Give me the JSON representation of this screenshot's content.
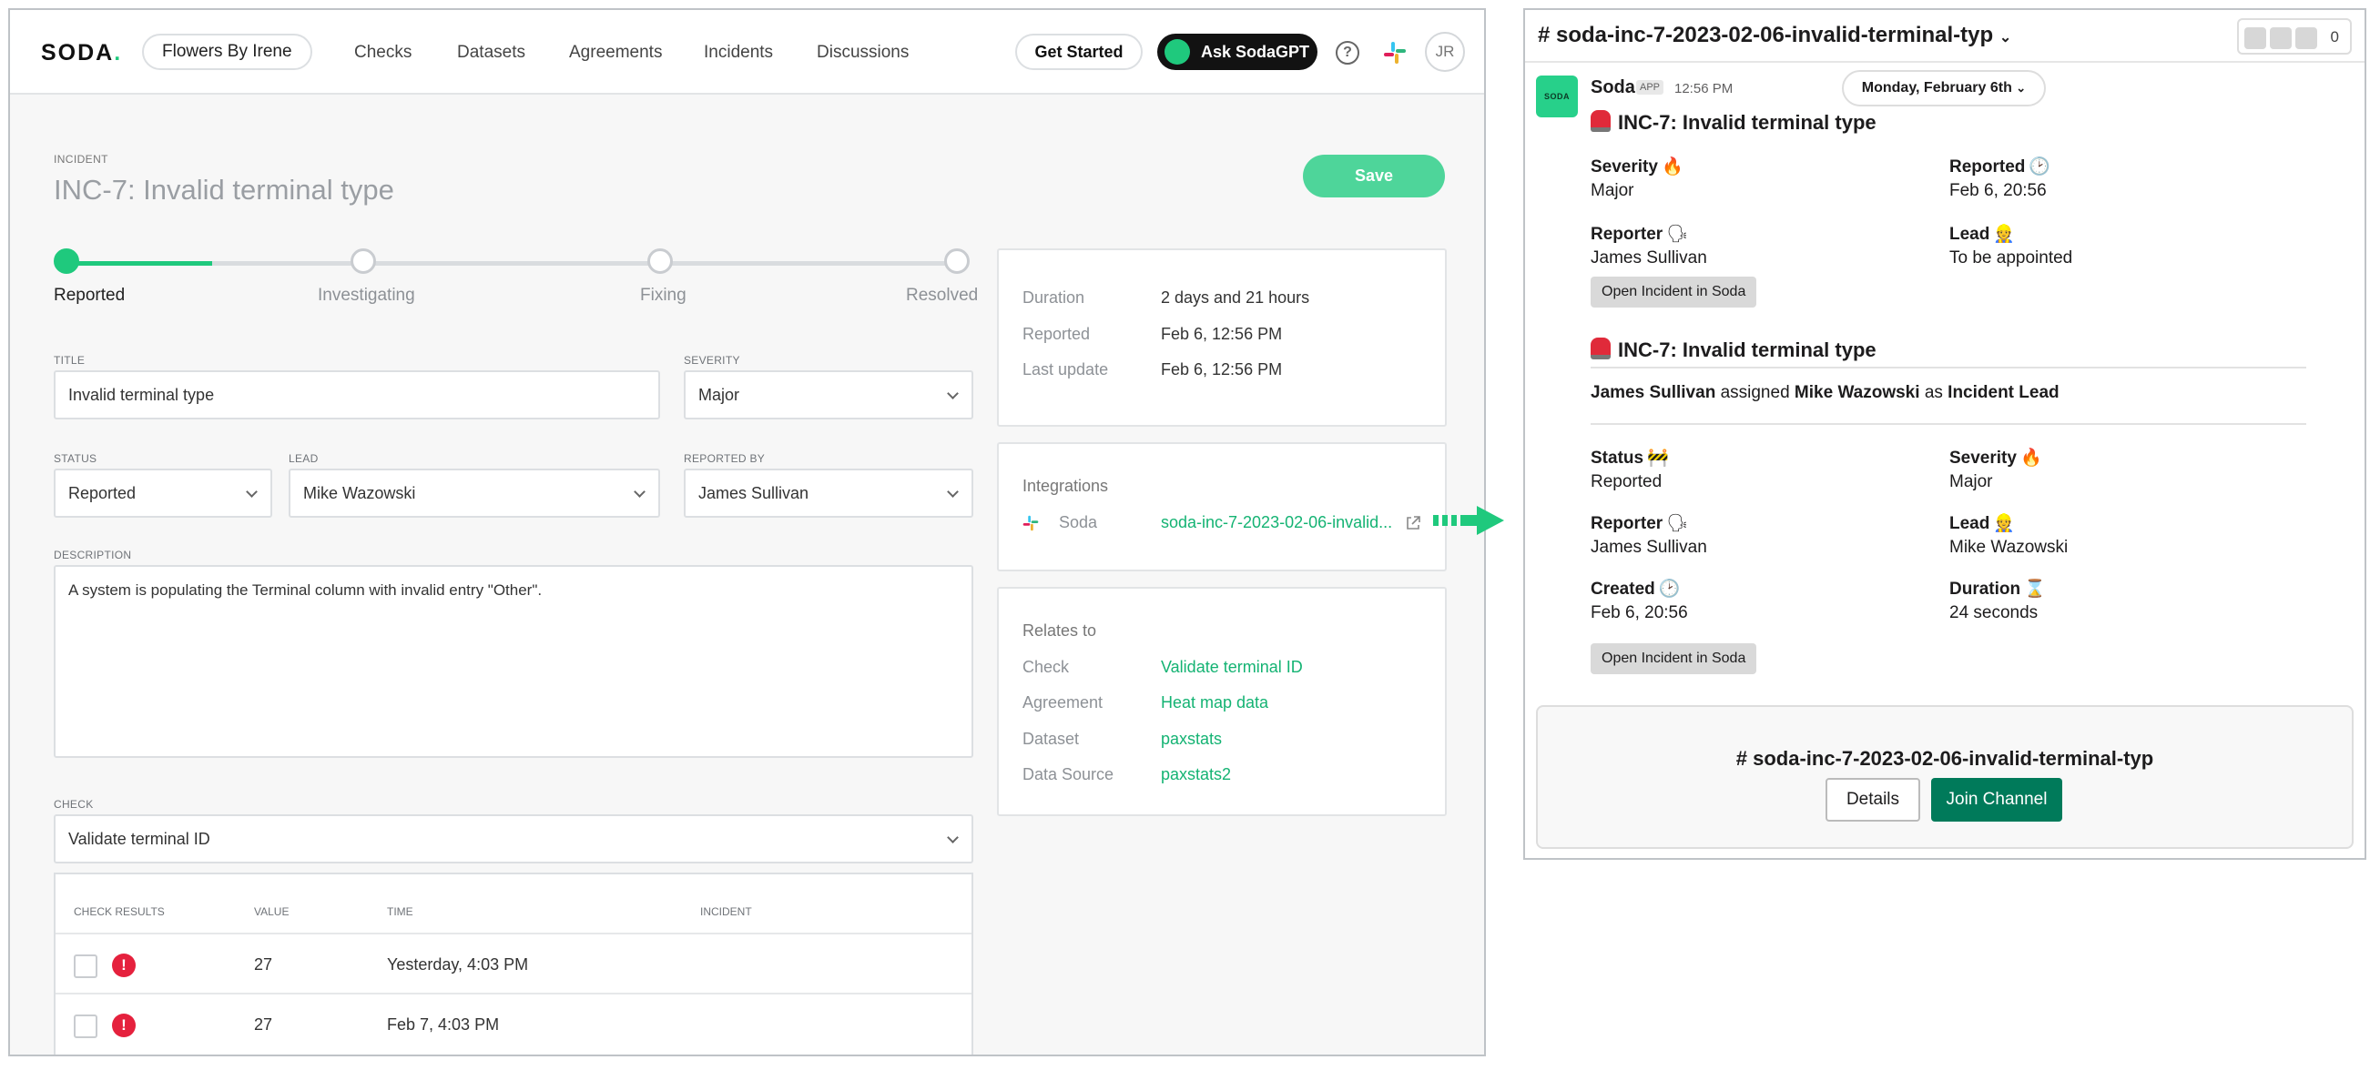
{
  "soda": {
    "logo": "SODA",
    "org": "Flowers By Irene",
    "nav": [
      "Checks",
      "Datasets",
      "Agreements",
      "Incidents",
      "Discussions"
    ],
    "get_started": "Get Started",
    "ask_gpt": "Ask SodaGPT",
    "help": "?",
    "avatar": "JR",
    "incident_label": "INCIDENT",
    "incident_title": "INC-7: Invalid terminal type",
    "save": "Save",
    "steps": [
      "Reported",
      "Investigating",
      "Fixing",
      "Resolved"
    ],
    "progress_step": 1,
    "title_label": "TITLE",
    "title_value": "Invalid terminal type",
    "severity_label": "SEVERITY",
    "severity_value": "Major",
    "status_label": "STATUS",
    "status_value": "Reported",
    "lead_label": "LEAD",
    "lead_value": "Mike Wazowski",
    "reported_by_label": "REPORTED BY",
    "reported_by_value": "James Sullivan",
    "description_label": "DESCRIPTION",
    "description_value": "A system is populating the Terminal column with invalid entry \"Other\".",
    "check_label": "CHECK",
    "check_value": "Validate terminal ID",
    "table_headers": [
      "CHECK RESULTS",
      "VALUE",
      "TIME",
      "INCIDENT"
    ],
    "table_rows": [
      {
        "value": "27",
        "time": "Yesterday, 4:03 PM"
      },
      {
        "value": "27",
        "time": "Feb 7, 4:03 PM"
      }
    ],
    "info": {
      "duration_k": "Duration",
      "duration_v": "2 days and 21 hours",
      "reported_k": "Reported",
      "reported_v": "Feb 6, 12:56 PM",
      "last_update_k": "Last update",
      "last_update_v": "Feb 6, 12:56 PM"
    },
    "integrations": {
      "title": "Integrations",
      "name": "Soda",
      "link": "soda-inc-7-2023-02-06-invalid..."
    },
    "relates": {
      "title": "Relates to",
      "check_k": "Check",
      "check_v": "Validate terminal ID",
      "agreement_k": "Agreement",
      "agreement_v": "Heat map data",
      "dataset_k": "Dataset",
      "dataset_v": "paxstats",
      "source_k": "Data Source",
      "source_v": "paxstats2"
    }
  },
  "slack": {
    "channel": "# soda-inc-7-2023-02-06-invalid-terminal-typ",
    "member_count": "0",
    "avatar_text": "SODA",
    "sender": "Soda",
    "app_badge": "APP",
    "time": "12:56 PM",
    "date_pill": "Monday, February 6th",
    "msg1": {
      "title": "INC-7: Invalid terminal type",
      "severity_k": "Severity",
      "severity_emo": "🔥",
      "severity_v": "Major",
      "reported_k": "Reported",
      "reported_emo": "🕑",
      "reported_v": "Feb 6, 20:56",
      "reporter_k": "Reporter",
      "reporter_emo": "🗣",
      "reporter_v": "James Sullivan",
      "lead_k": "Lead",
      "lead_emo": "👷",
      "lead_v": "To be appointed",
      "button": "Open Incident in Soda"
    },
    "msg2": {
      "title": "INC-7: Invalid terminal type",
      "assign_who": "James Sullivan",
      "assign_mid": " assigned ",
      "assign_whom": "Mike Wazowski",
      "assign_as": " as ",
      "assign_role": "Incident Lead",
      "status_k": "Status",
      "status_emo": "🚧",
      "status_v": "Reported",
      "severity_k": "Severity",
      "severity_emo": "🔥",
      "severity_v": "Major",
      "reporter_k": "Reporter",
      "reporter_emo": "🗣",
      "reporter_v": "James Sullivan",
      "lead_k": "Lead",
      "lead_emo": "👷",
      "lead_v": "Mike Wazowski",
      "created_k": "Created",
      "created_emo": "🕑",
      "created_v": "Feb 6, 20:56",
      "duration_k": "Duration",
      "duration_emo": "⌛",
      "duration_v": "24 seconds",
      "button": "Open Incident in Soda"
    },
    "join": {
      "title": "# soda-inc-7-2023-02-06-invalid-terminal-typ",
      "details": "Details",
      "join": "Join Channel"
    }
  }
}
